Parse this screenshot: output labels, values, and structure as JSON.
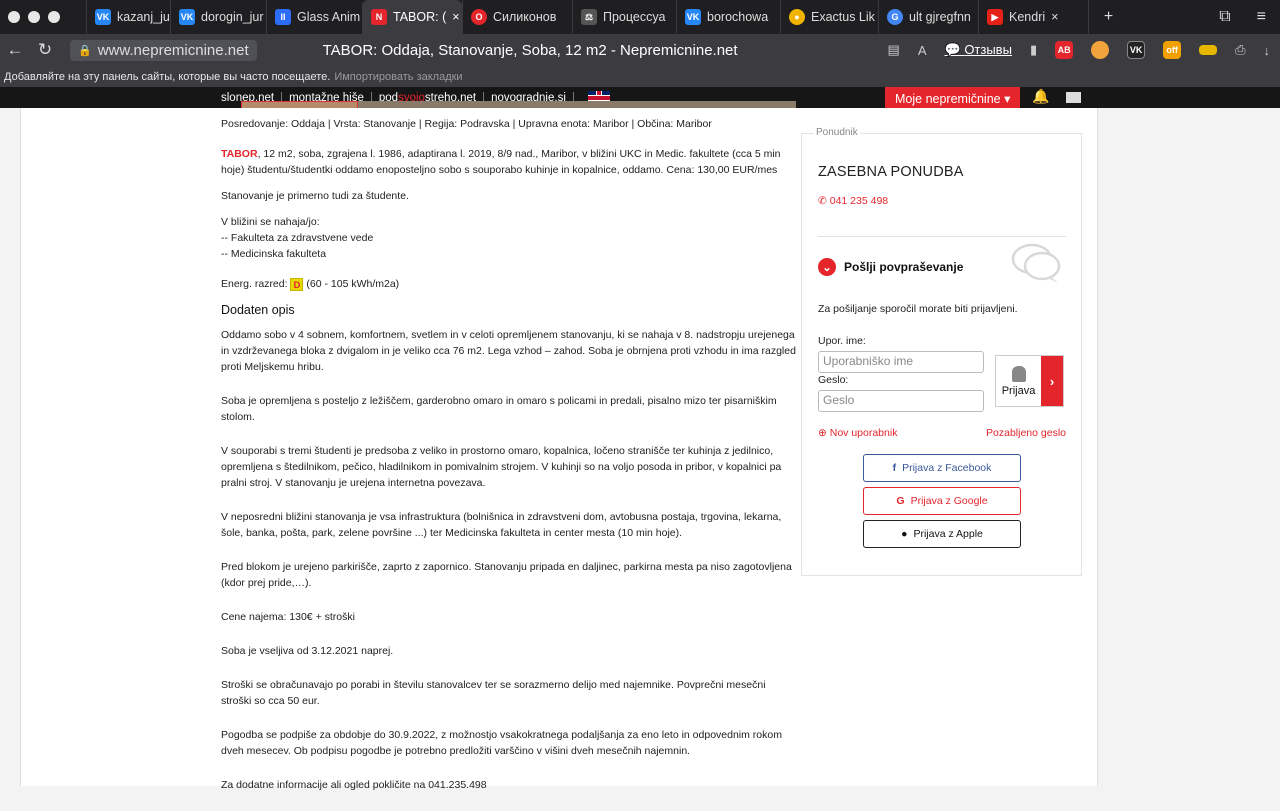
{
  "browser": {
    "tabs": [
      {
        "label": "kazanj_jury",
        "fav": "VK",
        "color": "#2787f5"
      },
      {
        "label": "dorogin_jur",
        "fav": "VK",
        "color": "#2787f5"
      },
      {
        "label": "Glass Anim",
        "fav": "II",
        "color": "#2d6df5"
      },
      {
        "label": "TABOR: (",
        "fav": "N",
        "color": "#e4252b",
        "active": true
      },
      {
        "label": "Силиконов",
        "fav": "O",
        "color": "#e4252b"
      },
      {
        "label": "Процессуа",
        "fav": "⚖",
        "color": "#555"
      },
      {
        "label": "borochowa",
        "fav": "VK",
        "color": "#2787f5"
      },
      {
        "label": "Exactus Lik",
        "fav": "●",
        "color": "#f0b400"
      },
      {
        "label": "ult gjregfnn",
        "fav": "G",
        "color": "#4285f4"
      },
      {
        "label": "Kendri",
        "fav": "▶",
        "color": "#e62117"
      }
    ],
    "url": "www.nepremicnine.net",
    "page_title": "TABOR: Oddaja, Stanovanje, Soba, 12 m2 - Nepremicnine.net",
    "reviews_label": "Отзывы",
    "bookmarks_text": "Добавляйте на эту панель сайты, которые вы часто посещаете.",
    "bookmarks_import": "Импортировать закладки"
  },
  "site": {
    "nav": [
      "slonep.net",
      "montažne hiše",
      "nov",
      "novogradnje.si"
    ],
    "nav_podsvojo": {
      "a": "pod",
      "b": "svojo",
      "c": "streho.net"
    },
    "my_button": "Moje nepremičnine ▾"
  },
  "listing": {
    "breadcrumb": "Posredovanje: Oddaja | Vrsta: Stanovanje | Regija: Podravska | Upravna enota: Maribor | Občina: Maribor",
    "title_word": "TABOR",
    "summary": ", 12 m2, soba, zgrajena l. 1986, adaptirana l. 2019, 8/9 nad., Maribor, v bližini UKC in Medic. fakultete (cca 5 min hoje) študentu/študentki oddamo enoposteljno sobo s souporabo kuhinje in kopalnice, oddamo. Cena: 130,00 EUR/mes",
    "line2": "Stanovanje je primerno tudi za študente.",
    "nearby_title": "V bližini se nahaja/jo:",
    "nearby": [
      "-- Fakulteta za zdravstvene vede",
      "-- Medicinska fakulteta"
    ],
    "energy_label": "Energ. razred:",
    "energy_class": "D",
    "energy_range": "(60 - 105 kWh/m2a)",
    "desc_heading": "Dodaten opis",
    "paragraphs": [
      "Oddamo sobo v 4 sobnem, komfortnem, svetlem in v celoti opremljenem stanovanju, ki se nahaja v 8. nadstropju urejenega in vzdrževanega bloka z dvigalom in je veliko cca 76 m2. Lega vzhod – zahod. Soba je obrnjena proti vzhodu in ima razgled proti Meljskemu hribu.",
      "Soba je opremljena s posteljo z ležiščem, garderobno omaro in omaro s policami in predali, pisalno mizo ter pisarniškim stolom.",
      "V souporabi s tremi študenti je predsoba z veliko in prostorno omaro, kopalnica, ločeno stranišče ter kuhinja z jedilnico, opremljena s štedilnikom, pečico, hladilnikom in pomivalnim strojem. V kuhinji so na voljo posoda in pribor, v kopalnici pa pralni stroj. V stanovanju je urejena internetna povezava.",
      "V neposredni bližini stanovanja je vsa infrastruktura (bolnišnica in zdravstveni dom, avtobusna postaja, trgovina, lekarna, šole, banka, pošta, park, zelene površine ...) ter Medicinska fakulteta in center mesta (10 min hoje).",
      "Pred blokom je urejeno parkirišče, zaprto z zapornico. Stanovanju pripada en daljinec, parkirna mesta pa niso zagotovljena (kdor prej pride,…).",
      "Cene najema: 130€ + stroški",
      "Soba je vseljiva od 3.12.2021 naprej.",
      "Stroški se obračunavajo po porabi in številu stanovalcev ter se sorazmerno delijo med najemnike. Povprečni mesečni stroški so cca 50 eur.",
      "Pogodba se podpiše za obdobje do 30.9.2022, z možnostjo vsakokratnega podaljšanja za eno leto in odpovednim rokom dveh mesecev. Ob podpisu pogodbe je potrebno predložiti varščino v višini dveh mesečnih najemnin.",
      "Za dodatne informacije ali ogled pokličite na 041.235.498"
    ]
  },
  "sidebar": {
    "legend": "Ponudnik",
    "offer": "ZASEBNA PONUDBA",
    "phone": "041 235 498",
    "send_title": "Pošlji povpraševanje",
    "login_note": "Za pošiljanje sporočil morate biti prijavljeni.",
    "username_label": "Upor. ime:",
    "username_placeholder": "Uporabniško ime",
    "password_label": "Geslo:",
    "password_placeholder": "Geslo",
    "login_button": "Prijava",
    "new_user": "Nov uporabnik",
    "forgot": "Pozabljeno geslo",
    "facebook": "Prijava z Facebook",
    "google": "Prijava z Google",
    "apple": "Prijava z Apple"
  }
}
